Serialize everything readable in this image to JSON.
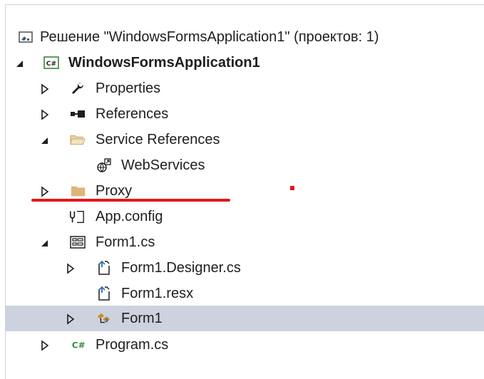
{
  "tree": {
    "solution_label": "Решение \"WindowsFormsApplication1\"  (проектов: 1)",
    "project_label": "WindowsFormsApplication1",
    "items": {
      "properties": "Properties",
      "references": "References",
      "service_references": "Service References",
      "webservices": "WebServices",
      "proxy": "Proxy",
      "app_config": "App.config",
      "form1_cs": "Form1.cs",
      "form1_designer": "Form1.Designer.cs",
      "form1_resx": "Form1.resx",
      "form1": "Form1",
      "program_cs": "Program.cs"
    },
    "selected_item": "Form1"
  },
  "colors": {
    "selection_background": "#cdd3de",
    "annotation_red": "#e2171f",
    "folder_yellow": "#dcb67a",
    "csharp_green": "#388a34",
    "form_orange": "#d08a2c"
  },
  "icons": {
    "solution": "solution-icon",
    "project": "csharp-project-icon",
    "properties": "wrench-icon",
    "references": "references-icon",
    "service_references": "folder-open-icon",
    "webservices": "web-service-icon",
    "proxy": "folder-icon",
    "app_config": "config-file-icon",
    "form1_cs": "form-file-icon",
    "form1_designer": "cs-file-icon",
    "form1_resx": "resx-file-icon",
    "form1": "form-class-icon",
    "program_cs": "csharp-file-icon"
  }
}
